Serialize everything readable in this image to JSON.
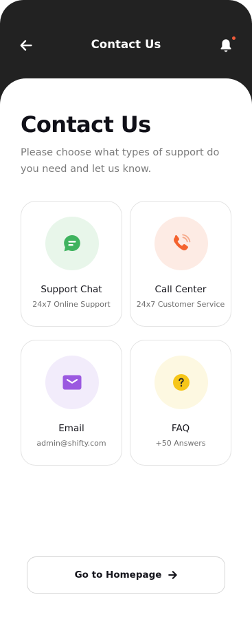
{
  "header": {
    "title": "Contact Us",
    "back_icon": "arrow-left-icon",
    "notification_icon": "bell-icon",
    "notification_dot_color": "#f05a3a",
    "background_color": "#222222"
  },
  "main": {
    "title": "Contact Us",
    "subtitle": "Please choose what types of support do you need and let us know."
  },
  "cards": [
    {
      "title": "Support Chat",
      "subtitle": "24x7 Online Support",
      "icon": "chat-bubble-icon",
      "icon_color": "#3fb35f",
      "bg_color": "#e8f6ea"
    },
    {
      "title": "Call Center",
      "subtitle": "24x7 Customer Service",
      "icon": "phone-icon",
      "icon_color": "#f4622e",
      "bg_color": "#fdebe4"
    },
    {
      "title": "Email",
      "subtitle": "admin@shifty.com",
      "icon": "envelope-icon",
      "icon_color": "#9b59e0",
      "bg_color": "#f2ecfb"
    },
    {
      "title": "FAQ",
      "subtitle": "+50 Answers",
      "icon": "question-icon",
      "icon_color": "#f6c619",
      "bg_color": "#fdf8e1"
    }
  ],
  "footer": {
    "button_label": "Go to Homepage",
    "button_icon": "arrow-right-icon"
  }
}
